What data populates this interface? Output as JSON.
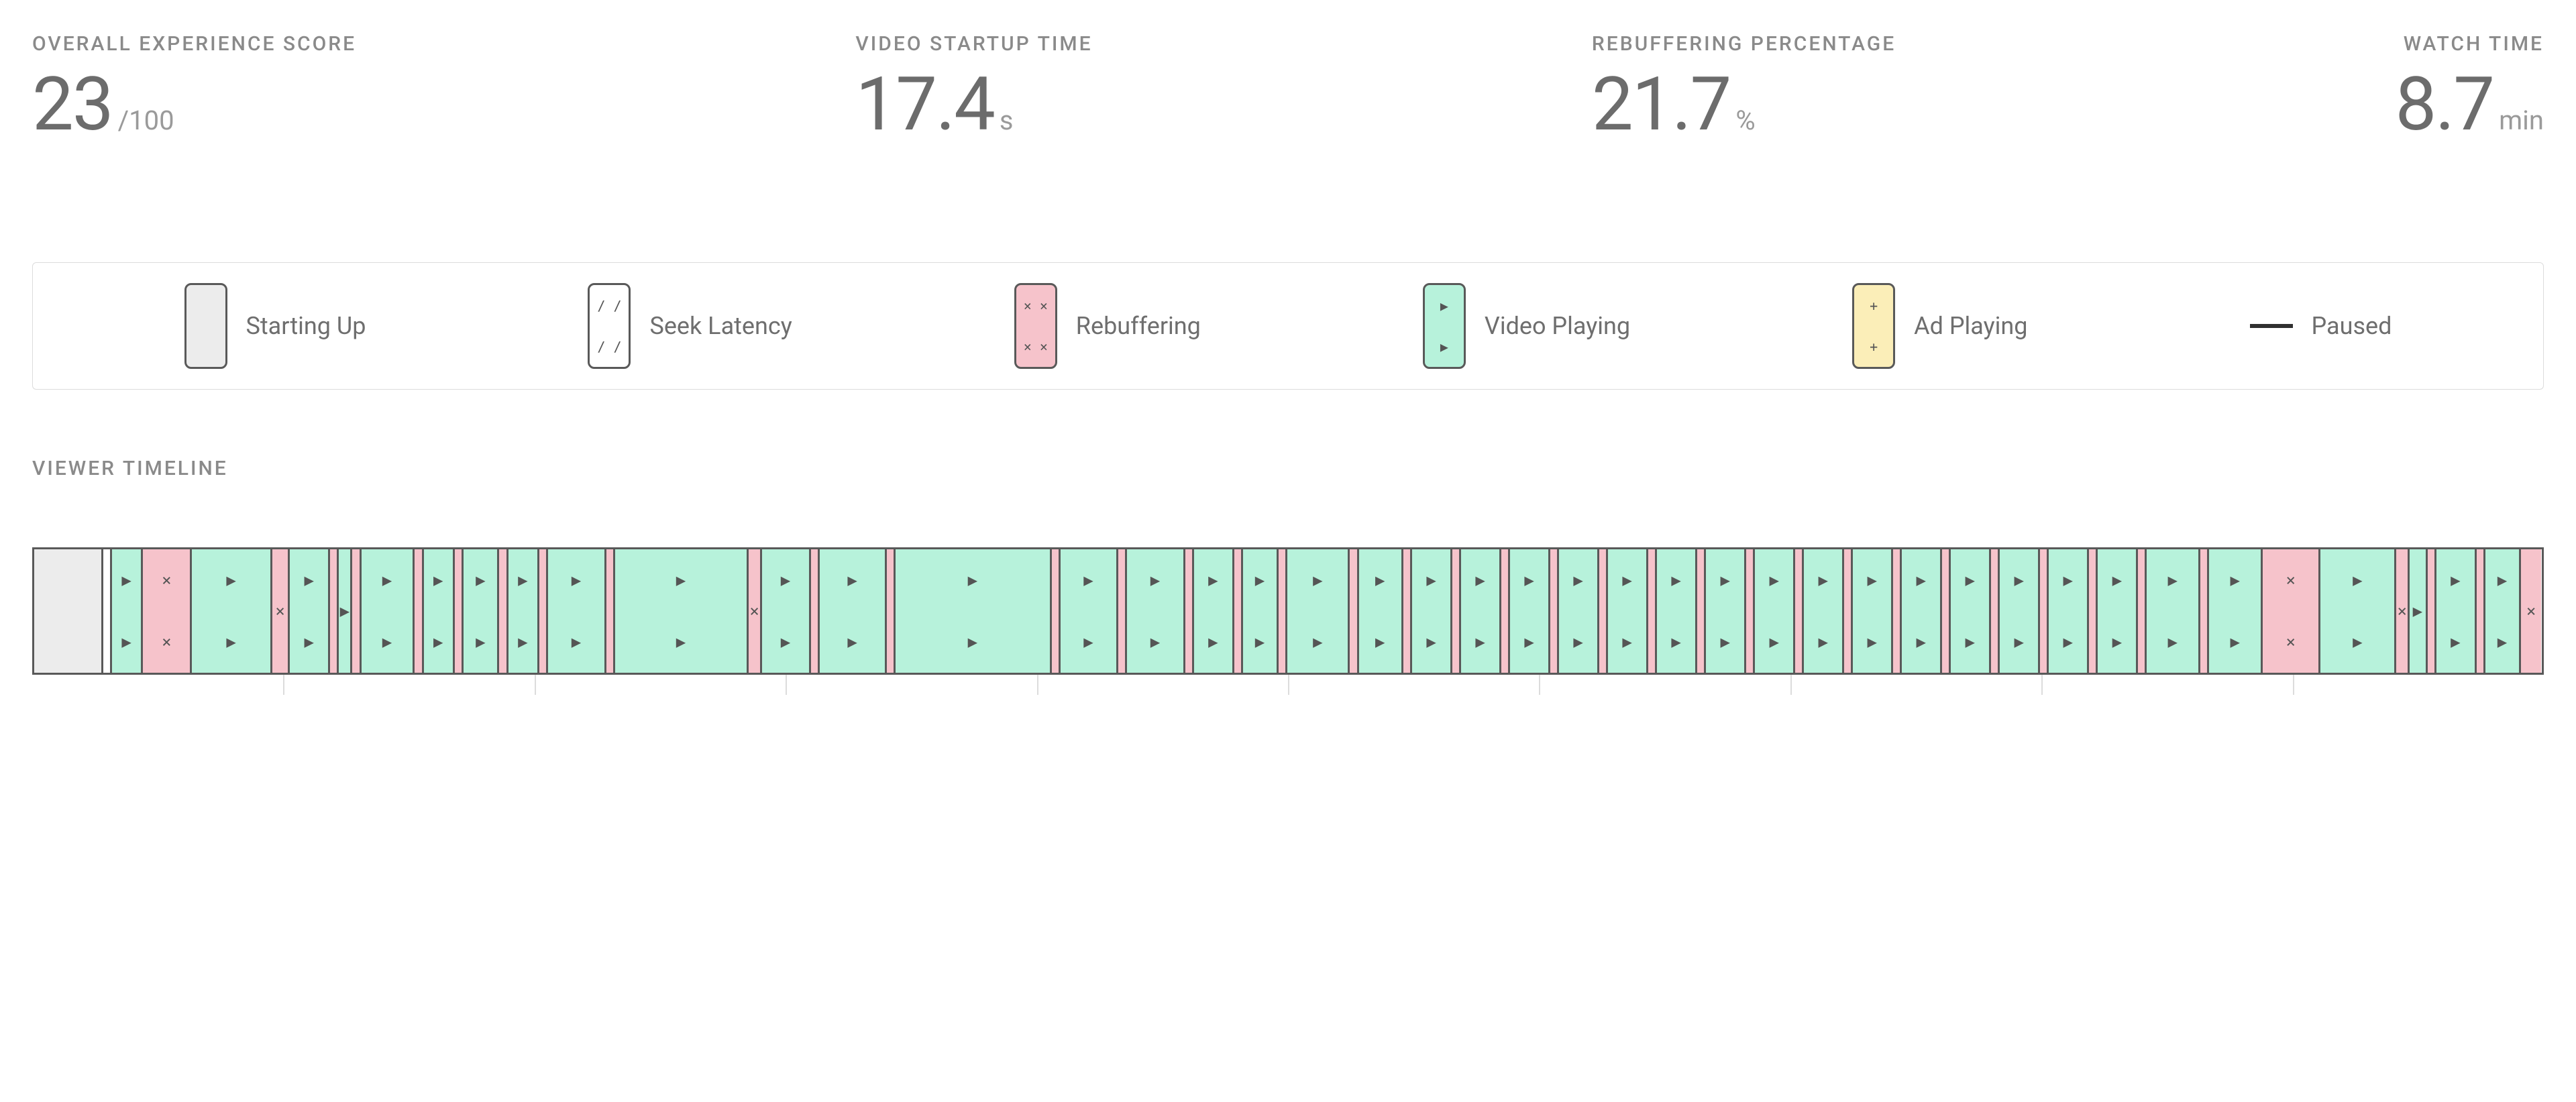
{
  "metrics": {
    "overall": {
      "label": "OVERALL EXPERIENCE SCORE",
      "value": "23",
      "unit": "/100"
    },
    "startup": {
      "label": "VIDEO STARTUP TIME",
      "value": "17.4",
      "unit": "s"
    },
    "rebuffer": {
      "label": "REBUFFERING PERCENTAGE",
      "value": "21.7",
      "unit": "%"
    },
    "watchtime": {
      "label": "WATCH TIME",
      "value": "8.7",
      "unit": "min"
    }
  },
  "legend": {
    "starting": "Starting Up",
    "seek": "Seek Latency",
    "rebuffer": "Rebuffering",
    "playing": "Video Playing",
    "ad": "Ad Playing",
    "paused": "Paused"
  },
  "section_title": "VIEWER TIMELINE",
  "chart_data": {
    "type": "timeline",
    "title": "Viewer Timeline",
    "states": {
      "starting_up": {
        "label": "Starting Up",
        "color": "#ececec"
      },
      "seek": {
        "label": "Seek Latency",
        "color": "#ffffff",
        "glyph": "/"
      },
      "rebuffer": {
        "label": "Rebuffering",
        "color": "#f6c3cb",
        "glyph": "×"
      },
      "playing": {
        "label": "Video Playing",
        "color": "#b7f2db",
        "glyph": "▶"
      },
      "ad": {
        "label": "Ad Playing",
        "color": "#fbeeb8",
        "glyph": "+"
      },
      "paused": {
        "label": "Paused",
        "color": "#303030"
      }
    },
    "segments": [
      {
        "state": "starting_up",
        "w": 30
      },
      {
        "state": "seek",
        "w": 4
      },
      {
        "state": "playing",
        "w": 14
      },
      {
        "state": "rebuffer",
        "w": 22
      },
      {
        "state": "playing",
        "w": 36
      },
      {
        "state": "rebuffer",
        "w": 8
      },
      {
        "state": "playing",
        "w": 18
      },
      {
        "state": "rebuffer",
        "w": 4
      },
      {
        "state": "playing",
        "w": 6
      },
      {
        "state": "rebuffer",
        "w": 4
      },
      {
        "state": "playing",
        "w": 24
      },
      {
        "state": "rebuffer",
        "w": 4
      },
      {
        "state": "playing",
        "w": 14
      },
      {
        "state": "rebuffer",
        "w": 4
      },
      {
        "state": "playing",
        "w": 16
      },
      {
        "state": "rebuffer",
        "w": 4
      },
      {
        "state": "playing",
        "w": 14
      },
      {
        "state": "rebuffer",
        "w": 4
      },
      {
        "state": "playing",
        "w": 26
      },
      {
        "state": "rebuffer",
        "w": 4
      },
      {
        "state": "playing",
        "w": 60
      },
      {
        "state": "rebuffer",
        "w": 6
      },
      {
        "state": "playing",
        "w": 22
      },
      {
        "state": "rebuffer",
        "w": 4
      },
      {
        "state": "playing",
        "w": 30
      },
      {
        "state": "rebuffer",
        "w": 4
      },
      {
        "state": "playing",
        "w": 70
      },
      {
        "state": "rebuffer",
        "w": 4
      },
      {
        "state": "playing",
        "w": 26
      },
      {
        "state": "rebuffer",
        "w": 4
      },
      {
        "state": "playing",
        "w": 26
      },
      {
        "state": "rebuffer",
        "w": 4
      },
      {
        "state": "playing",
        "w": 18
      },
      {
        "state": "rebuffer",
        "w": 4
      },
      {
        "state": "playing",
        "w": 16
      },
      {
        "state": "rebuffer",
        "w": 4
      },
      {
        "state": "playing",
        "w": 28
      },
      {
        "state": "rebuffer",
        "w": 4
      },
      {
        "state": "playing",
        "w": 20
      },
      {
        "state": "rebuffer",
        "w": 4
      },
      {
        "state": "playing",
        "w": 18
      },
      {
        "state": "rebuffer",
        "w": 4
      },
      {
        "state": "playing",
        "w": 18
      },
      {
        "state": "rebuffer",
        "w": 4
      },
      {
        "state": "playing",
        "w": 18
      },
      {
        "state": "rebuffer",
        "w": 4
      },
      {
        "state": "playing",
        "w": 18
      },
      {
        "state": "rebuffer",
        "w": 4
      },
      {
        "state": "playing",
        "w": 18
      },
      {
        "state": "rebuffer",
        "w": 4
      },
      {
        "state": "playing",
        "w": 18
      },
      {
        "state": "rebuffer",
        "w": 4
      },
      {
        "state": "playing",
        "w": 18
      },
      {
        "state": "rebuffer",
        "w": 4
      },
      {
        "state": "playing",
        "w": 18
      },
      {
        "state": "rebuffer",
        "w": 4
      },
      {
        "state": "playing",
        "w": 18
      },
      {
        "state": "rebuffer",
        "w": 4
      },
      {
        "state": "playing",
        "w": 18
      },
      {
        "state": "rebuffer",
        "w": 4
      },
      {
        "state": "playing",
        "w": 18
      },
      {
        "state": "rebuffer",
        "w": 4
      },
      {
        "state": "playing",
        "w": 18
      },
      {
        "state": "rebuffer",
        "w": 4
      },
      {
        "state": "playing",
        "w": 18
      },
      {
        "state": "rebuffer",
        "w": 4
      },
      {
        "state": "playing",
        "w": 18
      },
      {
        "state": "rebuffer",
        "w": 4
      },
      {
        "state": "playing",
        "w": 18
      },
      {
        "state": "rebuffer",
        "w": 4
      },
      {
        "state": "playing",
        "w": 24
      },
      {
        "state": "rebuffer",
        "w": 4
      },
      {
        "state": "playing",
        "w": 24
      },
      {
        "state": "rebuffer",
        "w": 26
      },
      {
        "state": "playing",
        "w": 34
      },
      {
        "state": "rebuffer",
        "w": 6
      },
      {
        "state": "playing",
        "w": 8
      },
      {
        "state": "rebuffer",
        "w": 4
      },
      {
        "state": "playing",
        "w": 18
      },
      {
        "state": "rebuffer",
        "w": 4
      },
      {
        "state": "playing",
        "w": 16
      },
      {
        "state": "rebuffer",
        "w": 10
      }
    ],
    "axis_ticks": [
      0,
      1,
      2,
      3,
      4,
      5,
      6,
      7,
      8,
      9
    ]
  }
}
